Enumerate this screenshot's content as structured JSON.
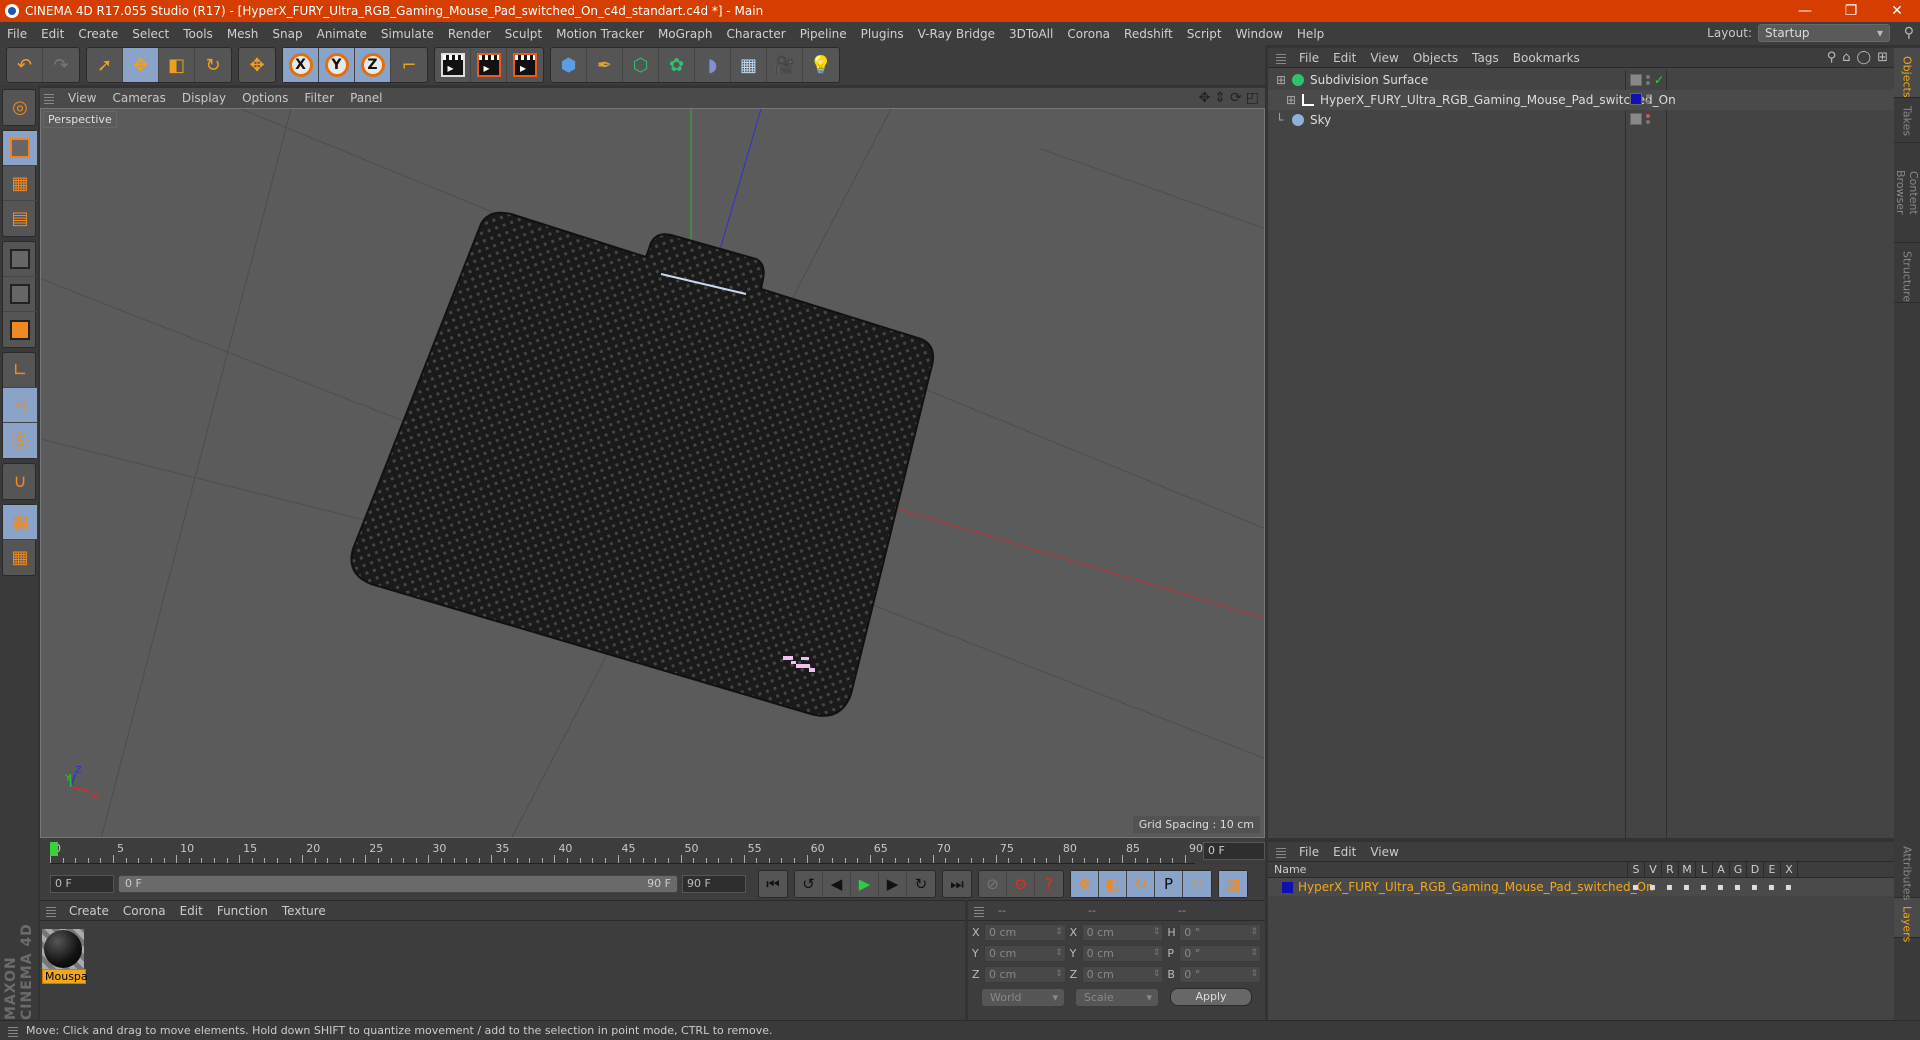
{
  "window": {
    "title": "CINEMA 4D R17.055 Studio (R17) - [HyperX_FURY_Ultra_RGB_Gaming_Mouse_Pad_switched_On_c4d_standart.c4d *] - Main",
    "controls": {
      "minimize": "—",
      "restore": "❐",
      "close": "✕"
    }
  },
  "menubar": {
    "items": [
      "File",
      "Edit",
      "Create",
      "Select",
      "Tools",
      "Mesh",
      "Snap",
      "Animate",
      "Simulate",
      "Render",
      "Sculpt",
      "Motion Tracker",
      "MoGraph",
      "Character",
      "Pipeline",
      "Plugins",
      "V-Ray Bridge",
      "3DToAll",
      "Corona",
      "Redshift",
      "Script",
      "Window",
      "Help"
    ],
    "layout_label": "Layout:",
    "layout_value": "Startup"
  },
  "toolbar": {
    "groups": [
      [
        {
          "icon": "undo-icon",
          "glyph": "↶",
          "active": false
        },
        {
          "icon": "redo-icon",
          "glyph": "↷",
          "active": false,
          "dim": true
        }
      ],
      [
        {
          "icon": "live-selection-icon",
          "glyph": "➚",
          "active": false
        },
        {
          "icon": "move-icon",
          "glyph": "✥",
          "active": true
        },
        {
          "icon": "scale-icon",
          "glyph": "◧",
          "active": false
        },
        {
          "icon": "rotate-icon",
          "glyph": "↻",
          "active": false
        }
      ],
      [
        {
          "icon": "recent-tool-icon",
          "glyph": "✥",
          "active": false
        }
      ],
      [
        {
          "icon": "x-axis-icon",
          "axis": "X",
          "active": true
        },
        {
          "icon": "y-axis-icon",
          "axis": "Y",
          "active": true
        },
        {
          "icon": "z-axis-icon",
          "axis": "Z",
          "active": true
        },
        {
          "icon": "coordinate-system-icon",
          "glyph": "⌐",
          "active": false
        }
      ],
      [
        {
          "icon": "render-view-icon",
          "clap": true
        },
        {
          "icon": "render-picture-viewer-icon",
          "clap": true
        },
        {
          "icon": "render-settings-icon",
          "clap": true
        }
      ],
      [
        {
          "icon": "cube-icon",
          "glyph": "⬢",
          "color": "#5aa0e0"
        },
        {
          "icon": "pen-icon",
          "glyph": "✒",
          "color": "#e0a030"
        },
        {
          "icon": "subdivision-icon",
          "glyph": "⬡",
          "color": "#30c070"
        },
        {
          "icon": "cloner-icon",
          "glyph": "✿",
          "color": "#30c070"
        },
        {
          "icon": "deformer-icon",
          "glyph": "◗",
          "color": "#8090d0"
        },
        {
          "icon": "floor-icon",
          "glyph": "▦",
          "color": "#c0d8f0"
        },
        {
          "icon": "camera-icon",
          "glyph": "🎥",
          "color": "#eee"
        },
        {
          "icon": "light-icon",
          "glyph": "💡",
          "color": "#eee"
        }
      ]
    ]
  },
  "left_tools": [
    [
      {
        "icon": "make-editable-icon",
        "active": false
      }
    ],
    [
      {
        "icon": "model-mode-icon",
        "active": true
      },
      {
        "icon": "texture-mode-icon",
        "active": false
      },
      {
        "icon": "workplane-mode-icon",
        "active": false
      }
    ],
    [
      {
        "icon": "points-mode-icon",
        "active": false
      },
      {
        "icon": "edges-mode-icon",
        "active": false
      },
      {
        "icon": "polygons-mode-icon",
        "active": false
      }
    ],
    [
      {
        "icon": "axis-mode-icon",
        "active": false
      },
      {
        "icon": "tweak-mode-icon",
        "active": true
      },
      {
        "icon": "solo-mode-icon",
        "active": true
      }
    ],
    [
      {
        "icon": "snap-icon",
        "active": false
      }
    ],
    [
      {
        "icon": "workplane-lock-icon",
        "active": true
      },
      {
        "icon": "workplane-align-icon",
        "active": false
      }
    ]
  ],
  "viewport": {
    "menu": [
      "View",
      "Cameras",
      "Display",
      "Options",
      "Filter",
      "Panel"
    ],
    "camera_label": "Perspective",
    "grid_spacing": "Grid Spacing : 10 cm",
    "nav_icons": [
      "move-view-icon",
      "dolly-icon",
      "orbit-icon",
      "maximize-icon"
    ],
    "axis_labels": {
      "x": "X",
      "y": "Y",
      "z": "Z"
    },
    "colors": {
      "x_axis": "#d03030",
      "y_axis": "#30c030",
      "z_axis": "#3030d0",
      "pad": "#1c1c1c",
      "logo": "#f0c0f0"
    }
  },
  "timeline": {
    "ticks": [
      "0",
      "5",
      "10",
      "15",
      "20",
      "25",
      "30",
      "35",
      "40",
      "45",
      "50",
      "55",
      "60",
      "65",
      "70",
      "75",
      "80",
      "85",
      "90"
    ],
    "current_frame": "0 F",
    "start_field": "0 F",
    "range_start": "0 F",
    "range_end": "90 F",
    "end_field": "90 F"
  },
  "playback": {
    "buttons": [
      {
        "icon": "go-to-start-icon",
        "glyph": "⏮"
      },
      {
        "icon": "previous-key-icon",
        "glyph": "↺"
      },
      {
        "icon": "step-back-icon",
        "glyph": "◀"
      },
      {
        "icon": "play-icon",
        "glyph": "▶"
      },
      {
        "icon": "step-forward-icon",
        "glyph": "▶"
      },
      {
        "icon": "next-key-icon",
        "glyph": "↻"
      },
      {
        "icon": "go-to-end-icon",
        "glyph": "⏭"
      }
    ],
    "record": [
      {
        "icon": "motion-path-icon",
        "glyph": "⊘"
      },
      {
        "icon": "record-keys-icon",
        "glyph": "⊙"
      },
      {
        "icon": "autokey-icon",
        "glyph": "?"
      }
    ],
    "key_filters": [
      {
        "icon": "key-position-icon",
        "glyph": "✥"
      },
      {
        "icon": "key-scale-icon",
        "glyph": "◧"
      },
      {
        "icon": "key-rotation-icon",
        "glyph": "↻"
      },
      {
        "icon": "key-param-icon",
        "glyph": "P"
      },
      {
        "icon": "key-pla-icon",
        "glyph": "⁙"
      }
    ],
    "timeline_icon": "film-strip-icon"
  },
  "materials": {
    "menu": [
      "Create",
      "Corona",
      "Edit",
      "Function",
      "Texture"
    ],
    "items": [
      {
        "name": "Mouspa"
      }
    ]
  },
  "coordinates": {
    "headers": [
      "--",
      "--",
      "--"
    ],
    "rows": [
      {
        "a": "X",
        "v1": "0 cm",
        "b": "X",
        "v2": "0 cm",
        "c": "H",
        "v3": "0 °"
      },
      {
        "a": "Y",
        "v1": "0 cm",
        "b": "Y",
        "v2": "0 cm",
        "c": "P",
        "v3": "0 °"
      },
      {
        "a": "Z",
        "v1": "0 cm",
        "b": "Z",
        "v2": "0 cm",
        "c": "B",
        "v3": "0 °"
      }
    ],
    "space": "World",
    "mode": "Scale",
    "apply": "Apply"
  },
  "objects": {
    "menu": [
      "File",
      "Edit",
      "View",
      "Objects",
      "Tags",
      "Bookmarks"
    ],
    "items": [
      {
        "name": "Subdivision Surface",
        "icon": "subdivision-surface-icon",
        "icon_color": "#30c070",
        "indent": 0,
        "tag": "gray",
        "check": "✓"
      },
      {
        "name": "HyperX_FURY_Ultra_RGB_Gaming_Mouse_Pad_switched_On",
        "icon": "null-object-icon",
        "icon_color": "#ffffff",
        "indent": 1,
        "tag": "blue"
      },
      {
        "name": "Sky",
        "icon": "sky-icon",
        "icon_color": "#8fb0d8",
        "indent": 0,
        "tag": "gray",
        "red_dot": true
      }
    ]
  },
  "side_tabs": [
    "Objects",
    "Takes",
    "Content Browser",
    "Structure"
  ],
  "side_tabs_lower": [
    "Attributes",
    "Layers"
  ],
  "layers": {
    "menu": [
      "File",
      "Edit",
      "View"
    ],
    "columns": [
      "Name",
      "S",
      "V",
      "R",
      "M",
      "L",
      "A",
      "G",
      "D",
      "E",
      "X"
    ],
    "items": [
      {
        "name": "HyperX_FURY_Ultra_RGB_Gaming_Mouse_Pad_switched_On",
        "color": "#1010b0"
      }
    ]
  },
  "status": {
    "text": "Move: Click and drag to move elements. Hold down SHIFT to quantize movement / add to the selection in point mode, CTRL to remove."
  },
  "brand": "MAXON CINEMA 4D"
}
